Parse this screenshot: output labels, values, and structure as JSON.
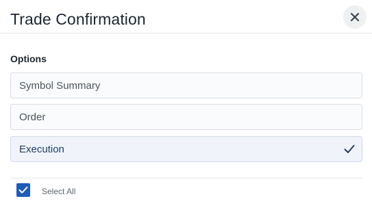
{
  "dialog": {
    "title": "Trade Confirmation",
    "close_icon": "close-icon"
  },
  "options_section": {
    "label": "Options",
    "items": [
      {
        "label": "Symbol Summary",
        "selected": false
      },
      {
        "label": "Order",
        "selected": false
      },
      {
        "label": "Execution",
        "selected": true
      }
    ],
    "check_icon": "checkmark-icon"
  },
  "select_all": {
    "label": "Select All",
    "checked": true
  },
  "colors": {
    "accent": "#1f5bb8",
    "selected_bg": "#f0f4fa",
    "check": "#1f3d66"
  }
}
